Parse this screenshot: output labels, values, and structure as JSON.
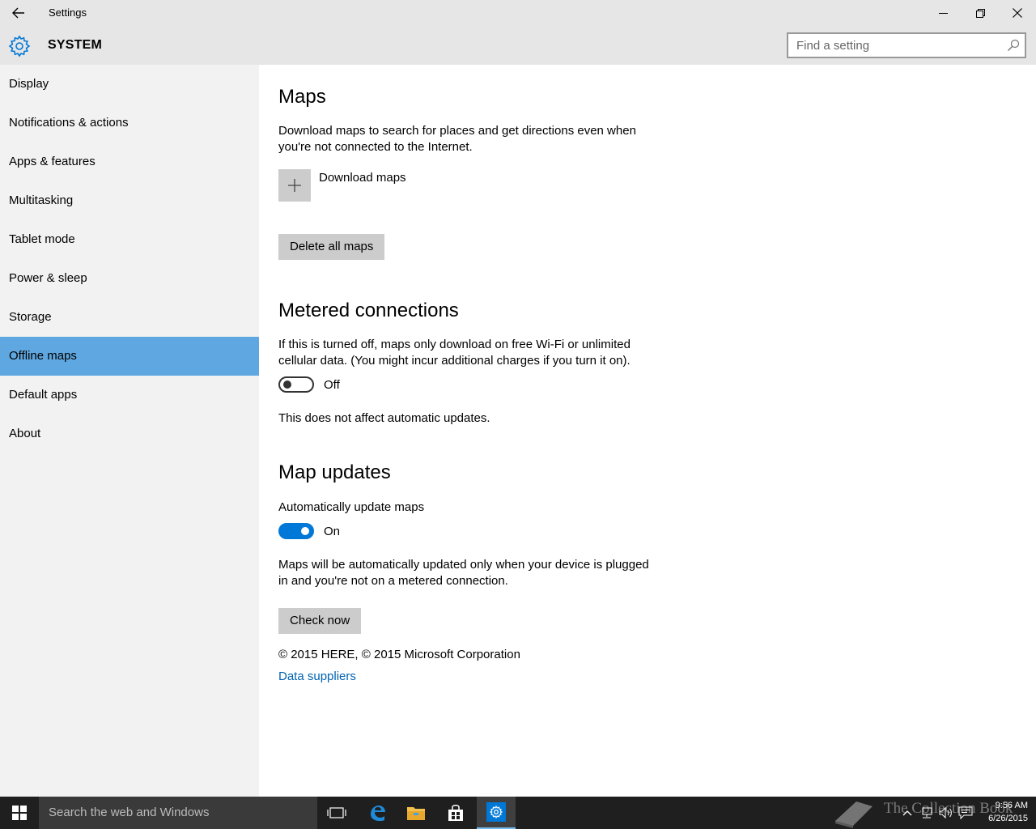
{
  "window": {
    "title": "Settings"
  },
  "header": {
    "section_title": "SYSTEM",
    "search_placeholder": "Find a setting"
  },
  "sidebar": {
    "items": [
      {
        "label": "Display"
      },
      {
        "label": "Notifications & actions"
      },
      {
        "label": "Apps & features"
      },
      {
        "label": "Multitasking"
      },
      {
        "label": "Tablet mode"
      },
      {
        "label": "Power & sleep"
      },
      {
        "label": "Storage"
      },
      {
        "label": "Offline maps",
        "active": true
      },
      {
        "label": "Default apps"
      },
      {
        "label": "About"
      }
    ]
  },
  "main": {
    "maps": {
      "heading": "Maps",
      "description": "Download maps to search for places and get directions even when you're not connected to the Internet.",
      "download_label": "Download maps",
      "delete_button": "Delete all maps"
    },
    "metered": {
      "heading": "Metered connections",
      "description": "If this is turned off, maps only download on free Wi-Fi or unlimited cellular data. (You might incur additional charges if you turn it on).",
      "toggle_state": "Off",
      "note": "This does not affect automatic updates."
    },
    "updates": {
      "heading": "Map updates",
      "toggle_title": "Automatically update maps",
      "toggle_state": "On",
      "description": "Maps will be automatically updated only when your device is plugged in and you're not on a metered connection.",
      "check_button": "Check now"
    },
    "copyright": "© 2015 HERE, © 2015 Microsoft Corporation",
    "data_suppliers_link": "Data suppliers"
  },
  "taskbar": {
    "search_placeholder": "Search the web and Windows",
    "watermark": "The Collection Book",
    "clock_time": "9:56 AM",
    "clock_date": "6/26/2015"
  },
  "colors": {
    "accent": "#0078d7",
    "nav_active": "#5ea7e0",
    "link": "#0063b1"
  }
}
